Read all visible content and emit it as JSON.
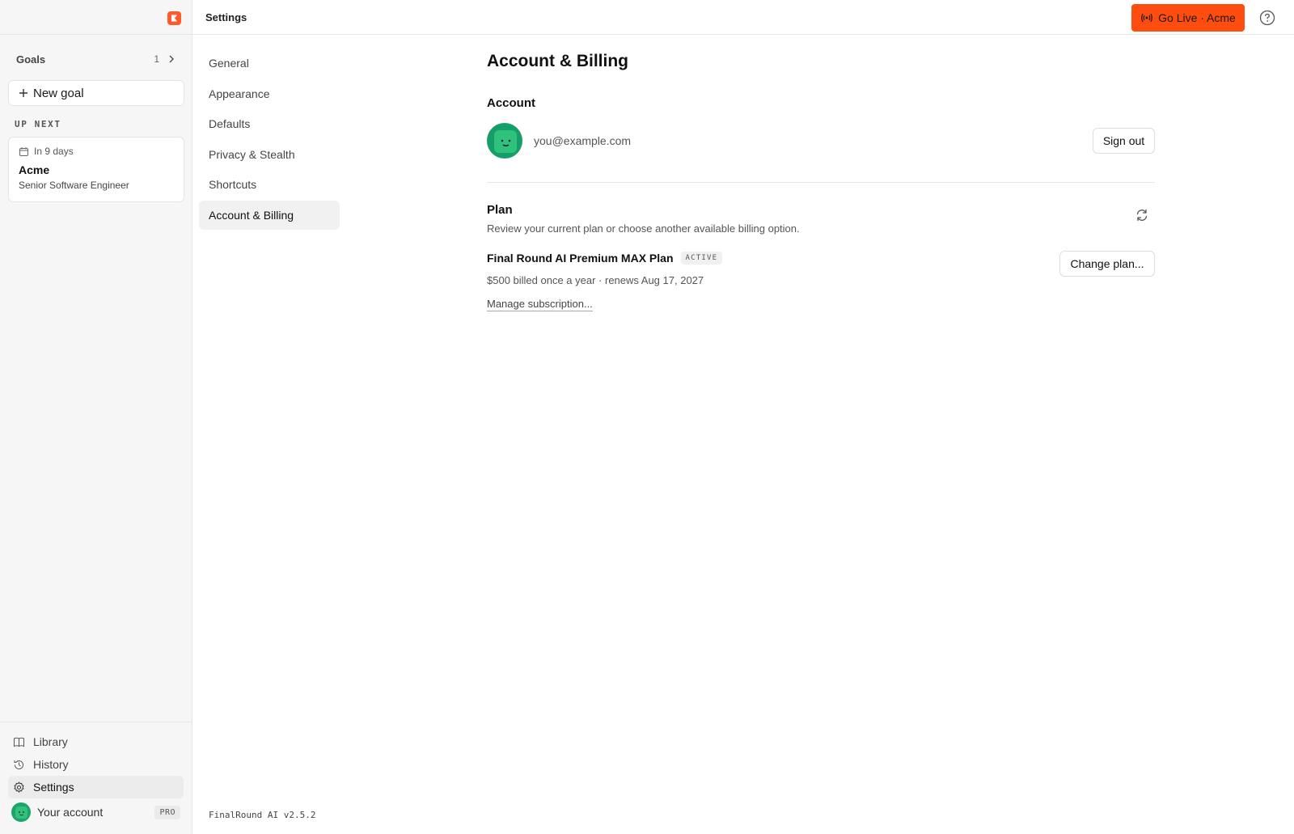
{
  "sidebar": {
    "goals_label": "Goals",
    "goals_count": "1",
    "new_goal_label": "New goal",
    "up_next_label": "UP NEXT",
    "up_next": {
      "when": "In 9 days",
      "company": "Acme",
      "role": "Senior Software Engineer"
    },
    "nav": [
      {
        "label": "Library",
        "icon": "book-icon"
      },
      {
        "label": "History",
        "icon": "history-icon"
      },
      {
        "label": "Settings",
        "icon": "gear-icon",
        "active": true
      }
    ],
    "account_label": "Your account",
    "account_badge": "PRO"
  },
  "topbar": {
    "title": "Settings",
    "go_live_label": "Go Live · Acme",
    "accent_color": "#ff4c0f"
  },
  "settings_nav": [
    {
      "label": "General"
    },
    {
      "label": "Appearance"
    },
    {
      "label": "Defaults"
    },
    {
      "label": "Privacy & Stealth"
    },
    {
      "label": "Shortcuts"
    },
    {
      "label": "Account & Billing",
      "active": true
    }
  ],
  "page": {
    "title": "Account & Billing",
    "account": {
      "section_title": "Account",
      "email": "you@example.com",
      "sign_out_label": "Sign out"
    },
    "plan": {
      "section_title": "Plan",
      "description": "Review your current plan or choose another available billing option.",
      "name": "Final Round AI Premium MAX Plan",
      "status_badge": "ACTIVE",
      "billing": "$500 billed once a year · renews Aug 17, 2027",
      "manage_label": "Manage subscription...",
      "change_label": "Change plan..."
    }
  },
  "footer": {
    "version": "FinalRound AI v2.5.2"
  }
}
